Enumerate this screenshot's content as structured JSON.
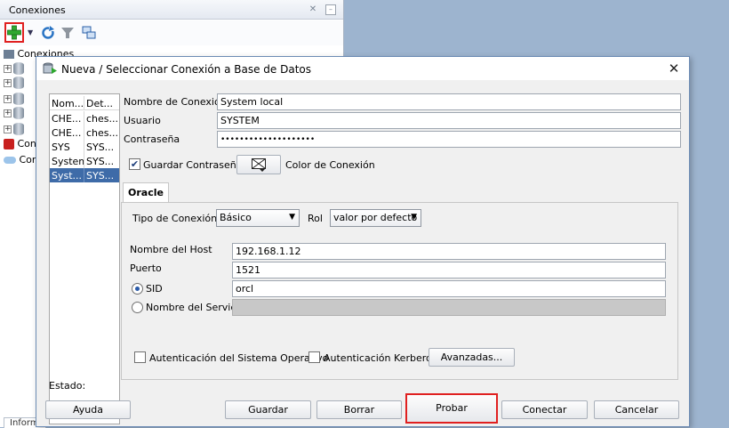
{
  "panel": {
    "title": "Conexiones",
    "tree_items": [
      "Conexiones",
      "",
      "",
      "",
      "",
      "",
      "Con",
      "Con"
    ],
    "bottom_tab": "Informe"
  },
  "dialog": {
    "title": "Nueva / Seleccionar Conexión a Base de Datos",
    "table": {
      "headers": [
        "Nom...",
        "Det..."
      ],
      "rows": [
        [
          "CHE...",
          "ches..."
        ],
        [
          "CHE...",
          "ches..."
        ],
        [
          "SYS",
          "SYS..."
        ],
        [
          "System",
          "SYS..."
        ],
        [
          "Syst...",
          "SYS..."
        ]
      ]
    },
    "form": {
      "connection_name_label": "Nombre de Conexión",
      "connection_name_value": "System local",
      "user_label": "Usuario",
      "user_value": "SYSTEM",
      "password_label": "Contraseña",
      "password_value": "••••••••••••••••••••",
      "save_password_label": "Guardar Contraseña",
      "save_password_checked": true,
      "color_label": "Color de Conexión"
    },
    "oracle_tab": {
      "tab_label": "Oracle",
      "connection_type_label": "Tipo de Conexión",
      "connection_type_value": "Básico",
      "role_label": "Rol",
      "role_value": "valor por defecto",
      "hostname_label": "Nombre del Host",
      "hostname_value": "192.168.1.12",
      "port_label": "Puerto",
      "port_value": "1521",
      "sid_label": "SID",
      "sid_value": "orcl",
      "sid_selected": true,
      "service_label": "Nombre del Servicio",
      "service_value": "",
      "os_auth_label": "Autenticación del Sistema Operativo",
      "kerberos_label": "Autenticación Kerberos",
      "advanced_label": "Avanzadas..."
    },
    "status_label": "Estado:",
    "buttons": {
      "help": "Ayuda",
      "save": "Guardar",
      "delete": "Borrar",
      "test": "Probar",
      "connect": "Conectar",
      "cancel": "Cancelar"
    }
  },
  "colors": {
    "highlight": "#e02020",
    "selection": "#3e6ba8",
    "desktop": "#9db4cf"
  }
}
